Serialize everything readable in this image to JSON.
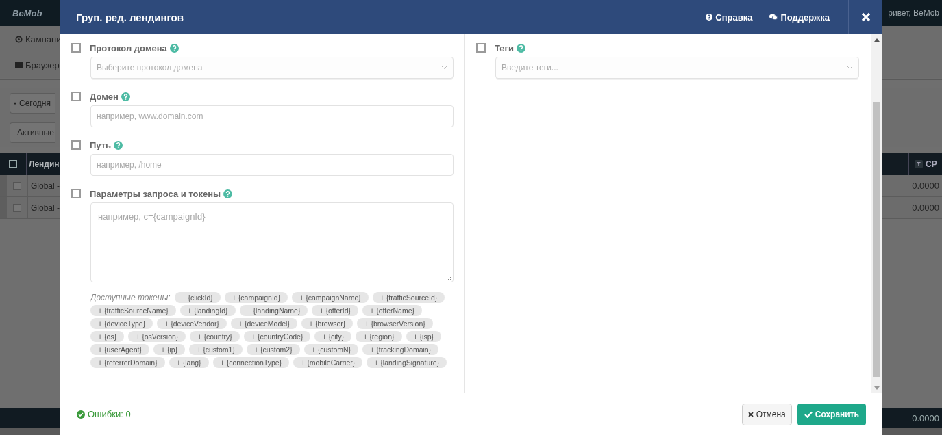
{
  "background": {
    "logo": "BeMob",
    "greeting": "ривет, BeMob",
    "nav": [
      "Кампани",
      "Браузер"
    ],
    "date_button": "Сегодня",
    "filter_button": "Активные",
    "table": {
      "column_1": "Лендин",
      "column_2": "CP",
      "header_checked": false,
      "rows": [
        {
          "checked": false,
          "column_1": "Global -",
          "column_2": "0.0000"
        },
        {
          "checked": false,
          "column_1": "Global -",
          "column_2": "0.0000"
        }
      ],
      "total": "0.0000"
    }
  },
  "modal": {
    "title": "Груп. ред. лендингов",
    "links": [
      {
        "kind": "help",
        "label": "Справка"
      },
      {
        "kind": "chat",
        "label": "Поддержка"
      }
    ],
    "left_fields": [
      {
        "kind": "select",
        "label": "Протокол домена",
        "checked": false,
        "placeholder": "Выберите протокол домена"
      },
      {
        "kind": "input",
        "label": "Домен",
        "checked": false,
        "placeholder": "например, www.domain.com"
      },
      {
        "kind": "input",
        "label": "Путь",
        "checked": false,
        "placeholder": "например, /home"
      },
      {
        "kind": "textarea",
        "label": "Параметры запроса и токены",
        "checked": false,
        "placeholder": "например, c={campaignId}"
      }
    ],
    "tokens_label": "Доступные токены:",
    "tokens": [
      "+ {clickId}",
      "+ {campaignId}",
      "+ {campaignName}",
      "+ {trafficSourceId}",
      "+ {trafficSourceName}",
      "+ {landingId}",
      "+ {landingName}",
      "+ {offerId}",
      "+ {offerName}",
      "+ {deviceType}",
      "+ {deviceVendor}",
      "+ {deviceModel}",
      "+ {browser}",
      "+ {browserVersion}",
      "+ {os}",
      "+ {osVersion}",
      "+ {country}",
      "+ {countryCode}",
      "+ {city}",
      "+ {region}",
      "+ {isp}",
      "+ {userAgent}",
      "+ {ip}",
      "+ {custom1}",
      "+ {custom2}",
      "+ {customN}",
      "+ {trackingDomain}",
      "+ {referrerDomain}",
      "+ {lang}",
      "+ {connectionType}",
      "+ {mobileCarrier}",
      "+ {landingSignature}"
    ],
    "right_fields": [
      {
        "kind": "select",
        "label": "Теги",
        "checked": false,
        "placeholder": "Введите теги..."
      }
    ],
    "errors": "Ошибки: 0",
    "cancel": "Отмена",
    "save": "Сохранить"
  }
}
